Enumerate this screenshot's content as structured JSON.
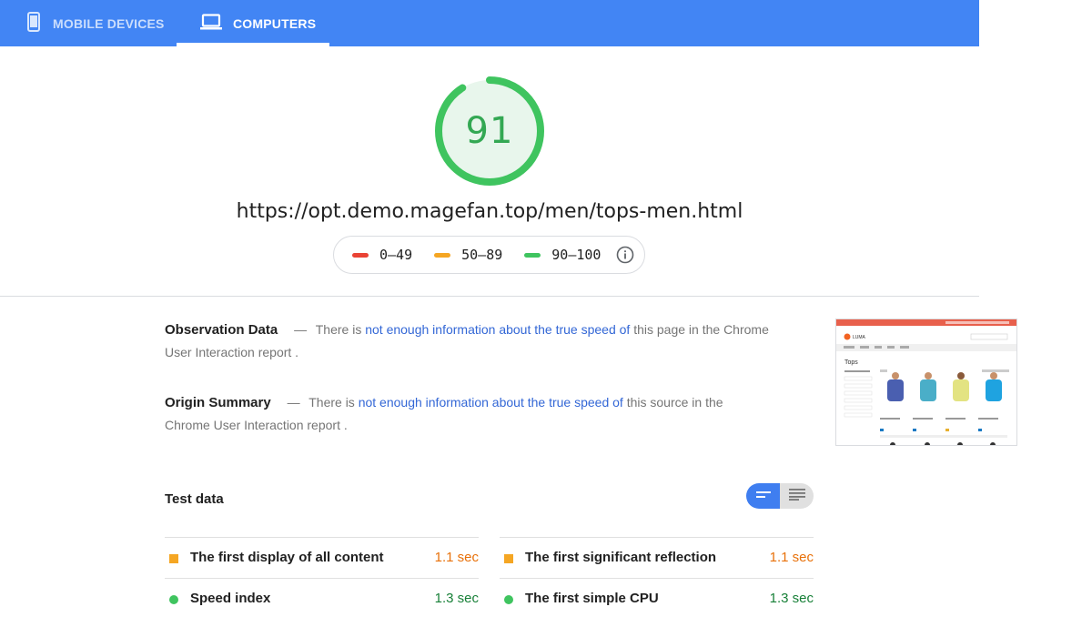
{
  "tabs": [
    {
      "label": "MOBILE DEVICES",
      "icon": "smartphone-icon",
      "active": false
    },
    {
      "label": "COMPUTERS",
      "icon": "laptop-icon",
      "active": true
    }
  ],
  "score": {
    "value": "91",
    "fraction": 0.91,
    "color": "#3fc45f"
  },
  "url": "https://opt.demo.magefan.top/men/tops-men.html",
  "legend": {
    "items": [
      {
        "range": "0–49",
        "color": "#ea4335"
      },
      {
        "range": "50–89",
        "color": "#f5a623"
      },
      {
        "range": "90–100",
        "color": "#3fc45f"
      }
    ],
    "info_icon": "info-icon"
  },
  "observation": {
    "title": "Observation Data",
    "dash": "—",
    "prefix": "There is",
    "link": "not enough information about the true speed of",
    "suffix": "this page in the Chrome User Interaction report ."
  },
  "origin": {
    "title": "Origin Summary",
    "dash": "—",
    "prefix": "There is",
    "link": "not enough information about the true speed of",
    "suffix": "this source in the Chrome User Interaction report ."
  },
  "test_data": {
    "title": "Test data",
    "metrics": [
      {
        "label": "The first display of all content",
        "value": "1.1 sec",
        "status": "average"
      },
      {
        "label": "The first significant reflection",
        "value": "1.1 sec",
        "status": "average"
      },
      {
        "label": "Speed index",
        "value": "1.3 sec",
        "status": "good"
      },
      {
        "label": "The first simple CPU",
        "value": "1.3 sec",
        "status": "good"
      }
    ]
  },
  "thumbnail": {
    "logo": "LUMA",
    "heading": "Tops"
  }
}
